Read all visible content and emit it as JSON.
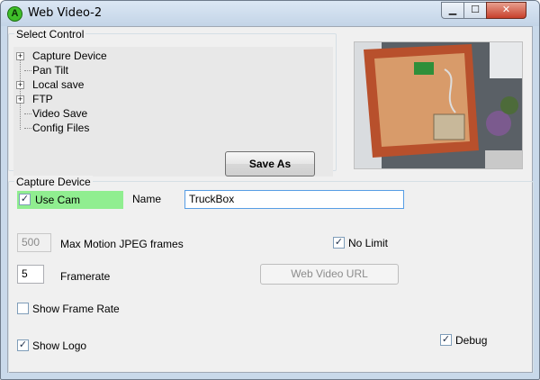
{
  "window": {
    "title": "Web Video-2",
    "app_icon_glyph": "A",
    "controls": {
      "minimize": "▁",
      "maximize": "☐",
      "close": "✕"
    }
  },
  "select_control": {
    "label": "Select Control",
    "tree": [
      {
        "label": "Capture Device",
        "expandable": true,
        "expander": "+"
      },
      {
        "label": "Pan Tilt",
        "expandable": false
      },
      {
        "label": "Local save",
        "expandable": true,
        "expander": "+"
      },
      {
        "label": "FTP",
        "expandable": true,
        "expander": "+"
      },
      {
        "label": "Video Save",
        "expandable": false
      },
      {
        "label": "Config Files",
        "expandable": false
      }
    ],
    "save_as_label": "Save As"
  },
  "capture_device": {
    "label": "Capture Device",
    "use_cam": {
      "label": "Use Cam",
      "checked": true,
      "highlight": "#90ee90"
    },
    "name_label": "Name",
    "name_value": "TruckBox",
    "max_frames_value": "500",
    "max_frames_label": "Max Motion JPEG frames",
    "no_limit": {
      "label": "No Limit",
      "checked": true
    },
    "framerate_value": "5",
    "framerate_label": "Framerate",
    "web_video_url_label": "Web Video URL",
    "show_frame_rate": {
      "label": "Show Frame Rate",
      "checked": false
    },
    "show_logo": {
      "label": "Show Logo",
      "checked": true
    },
    "debug": {
      "label": "Debug",
      "checked": true
    }
  },
  "check_glyph": "✓",
  "colors": {
    "titlebar": "#c9d9ea",
    "close_button": "#c7402b",
    "use_cam_highlight": "#90ee90"
  }
}
